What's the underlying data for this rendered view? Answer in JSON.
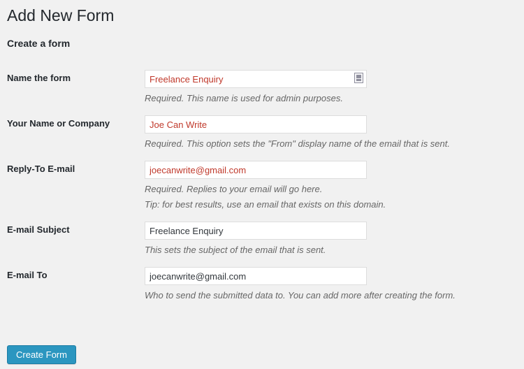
{
  "page": {
    "title": "Add New Form",
    "section_heading": "Create a form"
  },
  "colors": {
    "background": "#f1f1f1",
    "heading": "#23282d",
    "autofill_value": "#c0392b",
    "normal_value": "#32373c",
    "help_text": "#666666",
    "input_border": "#dddddd",
    "primary_button_bg": "#2b96c0",
    "primary_button_border": "#1b7ca3"
  },
  "fields": [
    {
      "label": "Name the form",
      "value": "Freelance Enquiry",
      "placeholder": "",
      "autofilled": true,
      "icon": "form-autofill-icon",
      "help": [
        "Required. This name is used for admin purposes."
      ]
    },
    {
      "label": "Your Name or Company",
      "value": "Joe Can Write",
      "placeholder": "",
      "autofilled": true,
      "icon": "",
      "help": [
        "Required. This option sets the \"From\" display name of the email that is sent."
      ]
    },
    {
      "label": "Reply-To E-mail",
      "value": "joecanwrite@gmail.com",
      "placeholder": "",
      "autofilled": true,
      "icon": "",
      "help": [
        "Required. Replies to your email will go here.",
        "Tip: for best results, use an email that exists on this domain."
      ]
    },
    {
      "label": "E-mail Subject",
      "value": "Freelance Enquiry",
      "placeholder": "",
      "autofilled": false,
      "icon": "",
      "help": [
        "This sets the subject of the email that is sent."
      ]
    },
    {
      "label": "E-mail To",
      "value": "joecanwrite@gmail.com",
      "placeholder": "",
      "autofilled": false,
      "icon": "",
      "help": [
        "Who to send the submitted data to. You can add more after creating the form."
      ]
    }
  ],
  "submit": {
    "label": "Create Form"
  }
}
